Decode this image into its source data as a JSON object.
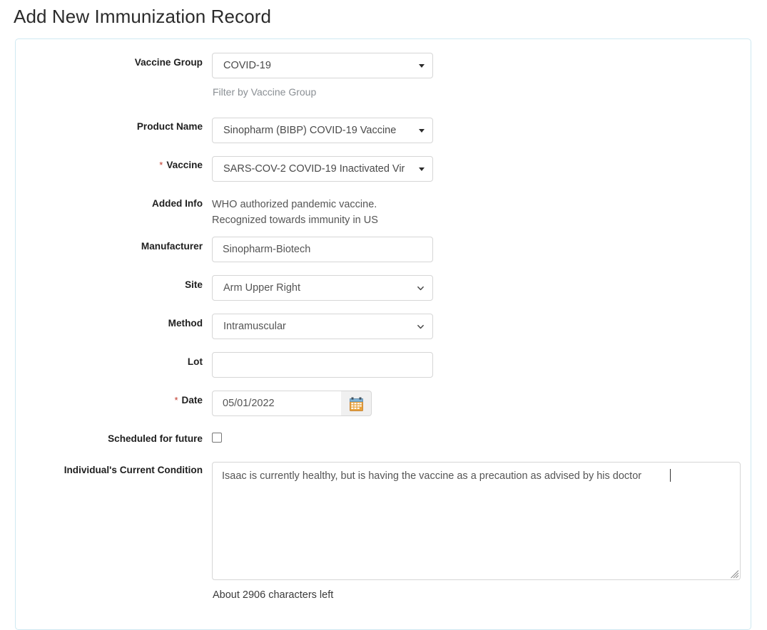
{
  "page": {
    "title": "Add New Immunization Record"
  },
  "colors": {
    "card_border": "#cfe9f2",
    "required_star": "#c0392b",
    "hint_text": "#8a8f94",
    "input_border": "#d6d6d6",
    "calendar_icon_header": "#4a90c4",
    "calendar_icon_body": "#e8a33d"
  },
  "form": {
    "vaccine_group": {
      "label": "Vaccine Group",
      "value": "COVID-19",
      "hint": "Filter by Vaccine Group",
      "required": false
    },
    "product_name": {
      "label": "Product Name",
      "value": "Sinopharm (BIBP) COVID-19 Vaccine",
      "required": false
    },
    "vaccine": {
      "label": "Vaccine",
      "value": "SARS-COV-2 COVID-19 Inactivated Vir",
      "required": true,
      "star": "*"
    },
    "added_info": {
      "label": "Added Info",
      "value": "WHO authorized pandemic vaccine.\nRecognized towards immunity in US"
    },
    "manufacturer": {
      "label": "Manufacturer",
      "value": "Sinopharm-Biotech",
      "placeholder": ""
    },
    "site": {
      "label": "Site",
      "value": "Arm Upper Right"
    },
    "method": {
      "label": "Method",
      "value": "Intramuscular"
    },
    "lot": {
      "label": "Lot",
      "value": "",
      "placeholder": ""
    },
    "date": {
      "label": "Date",
      "value": "05/01/2022",
      "required": true,
      "star": "*",
      "picker_icon": "calendar-icon"
    },
    "scheduled_for_future": {
      "label": "Scheduled for future",
      "checked": false
    },
    "current_condition": {
      "label": "Individual's Current Condition",
      "value": "Isaac is currently healthy, but is having the vaccine as a precaution as advised by his doctor",
      "counter": "About 2906 characters left"
    }
  }
}
